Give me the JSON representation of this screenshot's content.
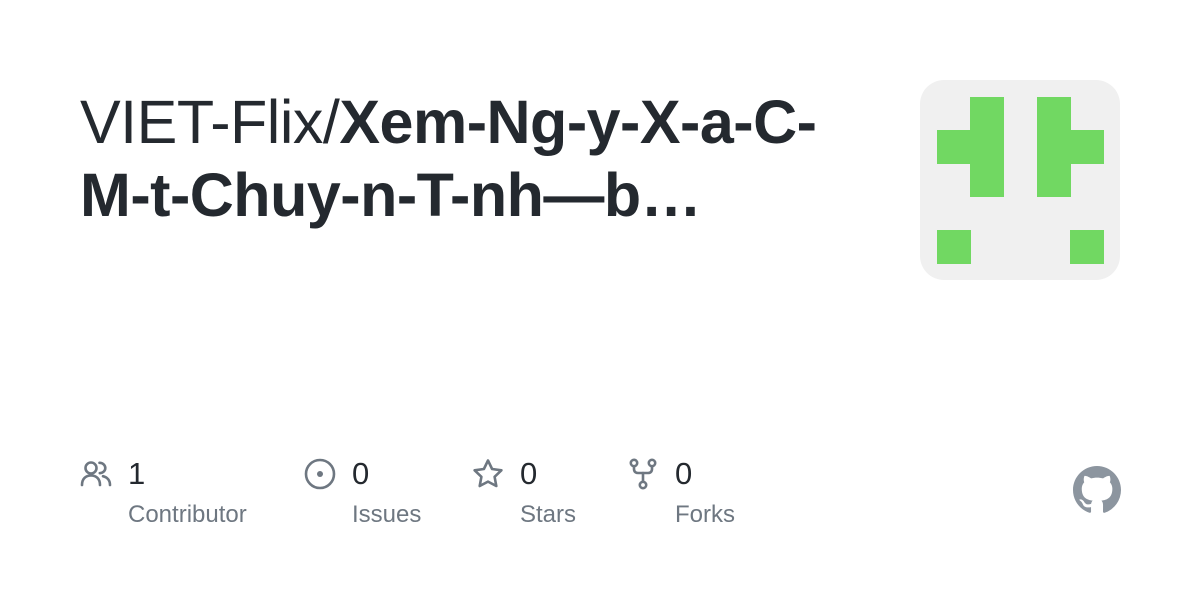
{
  "repo": {
    "owner": "VIET-Flix/",
    "name": "Xem-Ng-y-X-a-C-M-t-Chuy-n-T-nh—b…"
  },
  "avatar": {
    "background": "#f0f0f0",
    "pattern_color": "#71d862"
  },
  "stats": [
    {
      "value": "1",
      "label": "Contributor",
      "icon": "people-icon"
    },
    {
      "value": "0",
      "label": "Issues",
      "icon": "issue-opened-icon"
    },
    {
      "value": "0",
      "label": "Stars",
      "icon": "star-icon"
    },
    {
      "value": "0",
      "label": "Forks",
      "icon": "repo-forked-icon"
    }
  ],
  "colors": {
    "text": "#24292f",
    "muted": "#6e7781",
    "icon": "#6e7781",
    "github_logo": "#8c959f"
  }
}
